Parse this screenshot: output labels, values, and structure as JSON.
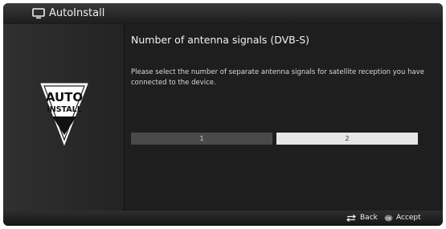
{
  "header": {
    "title": "AutoInstall",
    "icon": "tv-icon"
  },
  "logo": {
    "line1": "AUTO",
    "line2": "INSTALL",
    "icon": "auto-install-logo"
  },
  "main": {
    "heading": "Number of antenna signals (DVB-S)",
    "description": "Please select the number of separate antenna signals for satellite reception you have connected to the device.",
    "options": [
      {
        "label": "1",
        "selected": false
      },
      {
        "label": "2",
        "selected": true
      }
    ]
  },
  "footer": {
    "back_label": "Back",
    "back_icon": "back-arrows-icon",
    "accept_label": "Accept",
    "accept_icon": "ok-icon",
    "ok_key": "OK"
  },
  "colors": {
    "background": "#1a1a1a",
    "selected_option": "#e6e6e6",
    "unselected_option": "#4a4a4a",
    "text": "#f2f2f2"
  }
}
